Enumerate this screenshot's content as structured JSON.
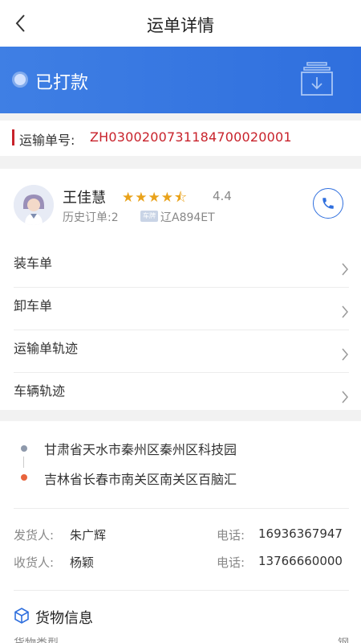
{
  "header": {
    "title": "运单详情",
    "back_icon": "chevron-left-icon"
  },
  "status": {
    "text": "已打款",
    "download_icon": "download-tray-icon"
  },
  "order": {
    "label": "运输单号:",
    "value": "ZH030020073118470002000​1"
  },
  "driver": {
    "name": "王佳慧",
    "stars": "★★★★⯪",
    "rating": "4.4",
    "history": "历史订单:2",
    "plate_tag": "车牌",
    "plate": "辽A894ET",
    "phone_icon": "phone-icon"
  },
  "menu": [
    {
      "label": "装车单"
    },
    {
      "label": "卸车单"
    },
    {
      "label": "运输单轨迹"
    },
    {
      "label": "车辆轨迹"
    }
  ],
  "route": {
    "origin": "甘肃省天水市秦州区秦州区科技园",
    "destination": "吉林省长春市南关区南关区百脑汇",
    "origin_color": "#8e99ab",
    "destination_color": "#e8643d"
  },
  "shipper": {
    "label": "发货人:",
    "name": "朱广辉",
    "tel_label": "电话:",
    "tel": "16936367947"
  },
  "receiver": {
    "label": "收货人:",
    "name": "杨颖",
    "tel_label": "电话:",
    "tel": "13766660000"
  },
  "cargo": {
    "title": "货物信息",
    "sub_left": "货物类型",
    "sub_right": "钢"
  },
  "colors": {
    "accent": "#2f6fde",
    "order_red": "#c8222b",
    "star": "#e9a21a"
  }
}
